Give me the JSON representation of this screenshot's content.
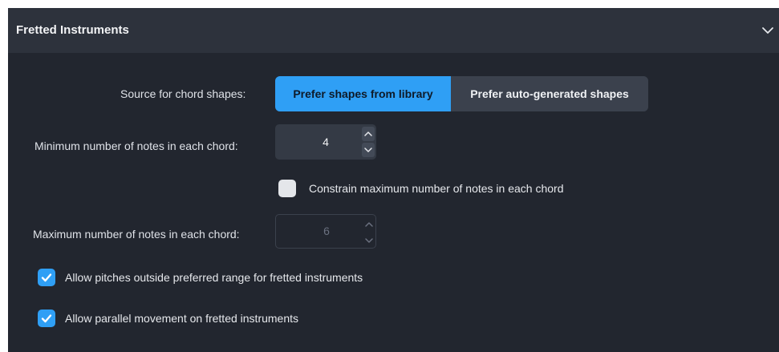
{
  "section": {
    "title": "Fretted Instruments",
    "collapse_icon": "chevron-down-icon"
  },
  "chord_shapes": {
    "label": "Source for chord shapes:",
    "options": [
      "Prefer shapes from library",
      "Prefer auto-generated shapes"
    ],
    "selected": "Prefer shapes from library"
  },
  "min_notes": {
    "label": "Minimum number of notes in each chord:",
    "value": "4",
    "enabled": true
  },
  "constrain_max": {
    "label": "Constrain maximum number of notes in each chord",
    "checked": false
  },
  "max_notes": {
    "label": "Maximum number of notes in each chord:",
    "value": "6",
    "enabled": false
  },
  "allow_pitches": {
    "label": "Allow pitches outside preferred range for fretted instruments",
    "checked": true
  },
  "allow_parallel": {
    "label": "Allow parallel movement on fretted instruments",
    "checked": true
  },
  "colors": {
    "accent": "#2f9ff5",
    "panel_bg": "#22262f",
    "header_bg": "#2d323c"
  }
}
